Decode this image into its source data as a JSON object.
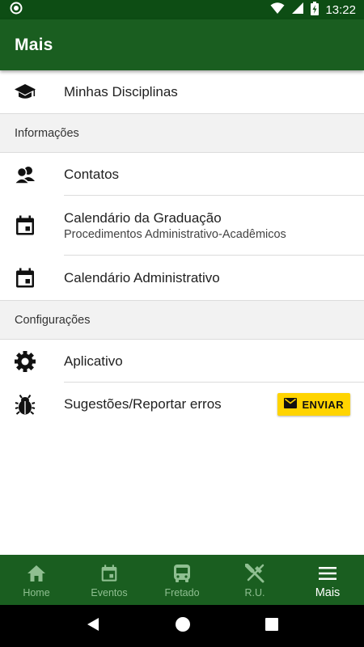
{
  "status_bar": {
    "time": "13:22"
  },
  "app_bar": {
    "title": "Mais"
  },
  "list": {
    "item_disciplinas": {
      "title": "Minhas Disciplinas",
      "icon": "graduation-cap-icon"
    },
    "section_informacoes": "Informações",
    "item_contatos": {
      "title": "Contatos",
      "icon": "contacts-icon"
    },
    "item_cal_graduacao": {
      "title": "Calendário da Graduação",
      "subtitle": "Procedimentos Administrativo-Acadêmicos",
      "icon": "calendar-icon"
    },
    "item_cal_admin": {
      "title": "Calendário Administrativo",
      "icon": "calendar-icon"
    },
    "section_config": "Configurações",
    "item_aplicativo": {
      "title": "Aplicativo",
      "icon": "gear-icon"
    },
    "item_sugestoes": {
      "title": "Sugestões/Reportar erros",
      "icon": "bug-icon",
      "button_label": "ENVIAR",
      "button_color": "#ffd400"
    }
  },
  "bottom_nav": {
    "items": [
      {
        "label": "Home",
        "icon": "home-icon",
        "active": false
      },
      {
        "label": "Eventos",
        "icon": "calendar-icon",
        "active": false
      },
      {
        "label": "Fretado",
        "icon": "bus-icon",
        "active": false
      },
      {
        "label": "R.U.",
        "icon": "restaurant-icon",
        "active": false
      },
      {
        "label": "Mais",
        "icon": "menu-icon",
        "active": true
      }
    ]
  },
  "colors": {
    "primary": "#1a5e20",
    "status_bar": "#0d4d14",
    "accent": "#ffd400",
    "inactive_nav": "#8fbf91"
  }
}
